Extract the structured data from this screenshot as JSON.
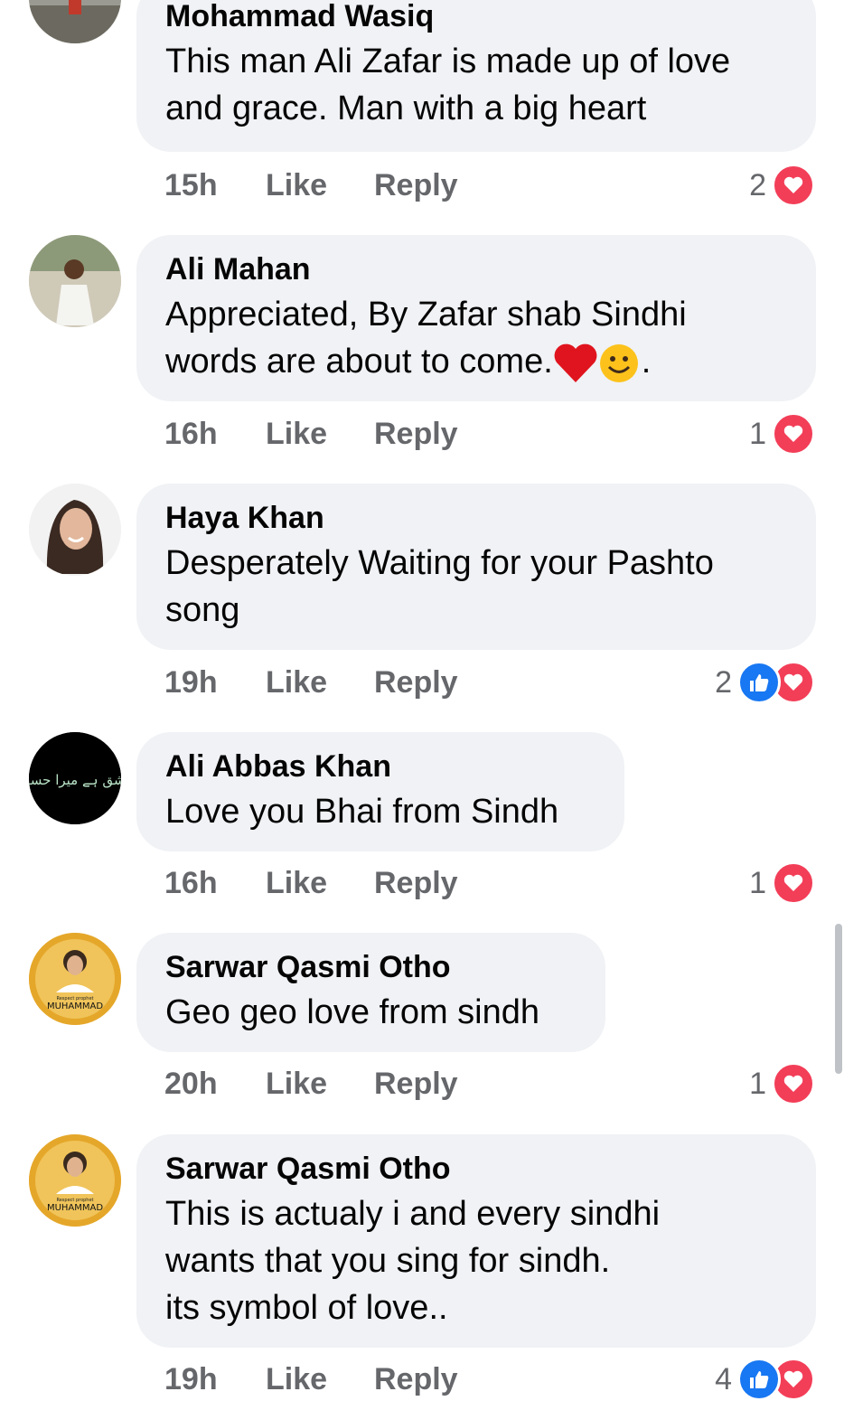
{
  "comments": [
    {
      "author": "Mohammad Wasiq",
      "text": "This man Ali Zafar is made up of love\nand grace. Man with a big heart",
      "time": "15h",
      "like_label": "Like",
      "reply_label": "Reply",
      "reaction_count": "2",
      "reactions": [
        "love"
      ]
    },
    {
      "author": "Ali Mahan",
      "text": "Appreciated, By Zafar shab Sindhi\nwords are about to come.",
      "emoji_suffix": [
        "heart-emoji",
        "smile-emoji"
      ],
      "text_end": ".",
      "time": "16h",
      "like_label": "Like",
      "reply_label": "Reply",
      "reaction_count": "1",
      "reactions": [
        "love"
      ]
    },
    {
      "author": "Haya Khan",
      "text": "Desperately Waiting for your Pashto\nsong",
      "time": "19h",
      "like_label": "Like",
      "reply_label": "Reply",
      "reaction_count": "2",
      "reactions": [
        "like",
        "love"
      ]
    },
    {
      "author": "Ali Abbas Khan",
      "text": "Love you Bhai from Sindh",
      "time": "16h",
      "like_label": "Like",
      "reply_label": "Reply",
      "reaction_count": "1",
      "reactions": [
        "love"
      ]
    },
    {
      "author": "Sarwar Qasmi Otho",
      "text": "Geo geo love from sindh",
      "time": "20h",
      "like_label": "Like",
      "reply_label": "Reply",
      "reaction_count": "1",
      "reactions": [
        "love"
      ]
    },
    {
      "author": "Sarwar Qasmi Otho",
      "text": "This is actualy i and every sindhi\nwants that you sing for sindh.\nits symbol of love..",
      "time": "19h",
      "like_label": "Like",
      "reply_label": "Reply",
      "reaction_count": "4",
      "reactions": [
        "like",
        "love"
      ]
    }
  ],
  "avatar_texts": {
    "ali_abbas": "عشق ہے میرا حسین",
    "sarwar_line1": "Respect prophet",
    "sarwar_line2": "MUHAMMAD"
  },
  "colors": {
    "bubble": "#f0f2f5",
    "meta": "#65676b",
    "love": "#f33e58",
    "like": "#1877f2"
  }
}
